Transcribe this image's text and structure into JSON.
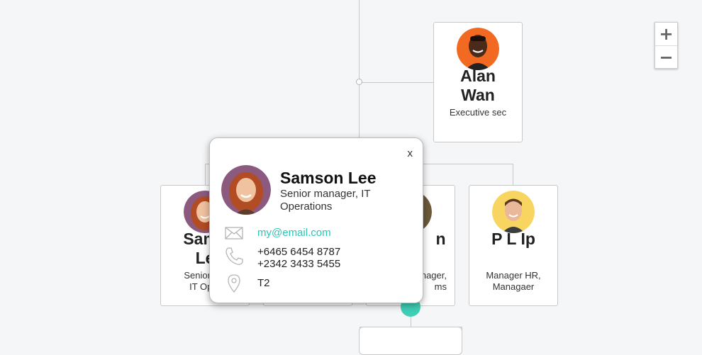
{
  "zoom": {
    "zoom_in": "+",
    "zoom_out": "−"
  },
  "nodes": [
    {
      "name": "Alan Wan",
      "name_lines": [
        "Alan",
        "Wan"
      ],
      "title_lines": [
        "Executive sec"
      ],
      "avatar_color": "#f26a21"
    },
    {
      "name_lines": [
        "Sams",
        "Le"
      ],
      "title_lines": [
        "Senior ma",
        "IT Oper"
      ],
      "avatar_color": "#8c5a7e"
    },
    {
      "name_lines": [
        "n"
      ],
      "title_lines": [
        "nager,",
        "ms"
      ]
    },
    {
      "name_lines": [
        "P L Ip"
      ],
      "title_lines": [
        "Manager HR,",
        "Managaer"
      ],
      "avatar_color": "#f7d560"
    }
  ],
  "popup": {
    "close_label": "x",
    "name": "Samson Lee",
    "title": "Senior manager, IT Operations",
    "email": "my@email.com",
    "phones": [
      "+6465 6454 8787",
      "+2342 3433 5455"
    ],
    "location": "T2"
  },
  "colors": {
    "accent": "#2cc4b6",
    "expander": "#3ecfb6",
    "line": "#c7c7c7"
  }
}
